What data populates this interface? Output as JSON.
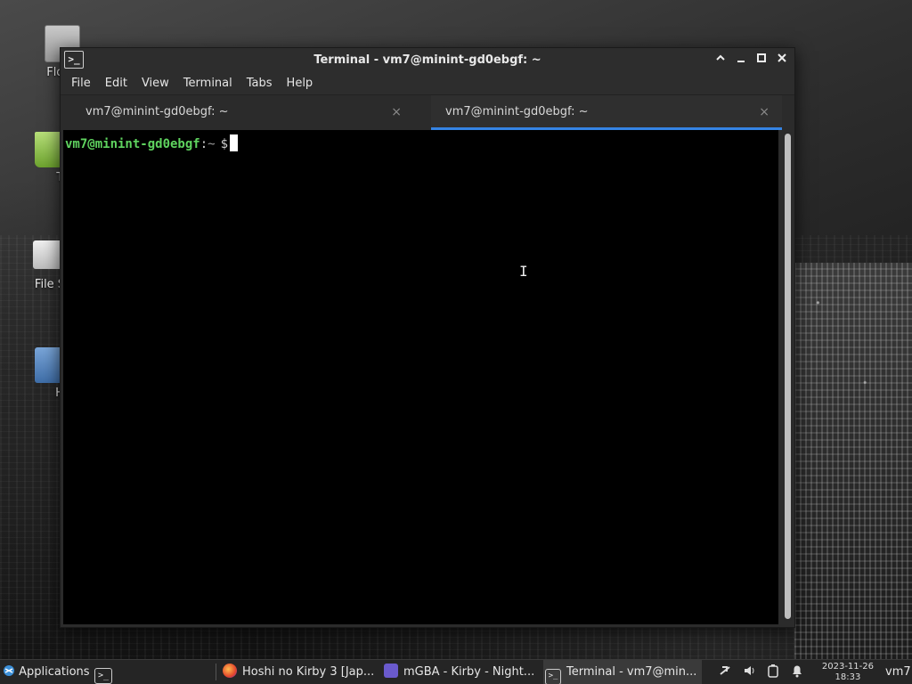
{
  "desktop": {
    "icons": [
      {
        "label": "Flopp"
      },
      {
        "label": "Tra"
      },
      {
        "label": "File S"
      },
      {
        "label": "Ho"
      }
    ]
  },
  "window": {
    "title": "Terminal - vm7@minint-gd0ebgf: ~",
    "controls": {
      "up": "▲",
      "minimize": "_",
      "maximize": "□",
      "close": "✕"
    },
    "menu": [
      "File",
      "Edit",
      "View",
      "Terminal",
      "Tabs",
      "Help"
    ],
    "tabs": [
      {
        "label": "vm7@minint-gd0ebgf: ~",
        "close": "×"
      },
      {
        "label": "vm7@minint-gd0ebgf: ~",
        "close": "×"
      }
    ],
    "terminal": {
      "user_host": "vm7@minint-gd0ebgf",
      "colon": ":",
      "path": "~",
      "symbol": "$"
    }
  },
  "taskbar": {
    "applications_label": "Applications",
    "tasks": [
      {
        "label": "Hoshi no Kirby 3 [Jap..."
      },
      {
        "label": "mGBA - Kirby - Night..."
      },
      {
        "label": "Terminal - vm7@min..."
      }
    ],
    "clock": {
      "date": "2023-11-26",
      "time": "18:33"
    },
    "user": "vm7"
  },
  "colors": {
    "accent": "#3584e4",
    "prompt_user": "#5fd35f",
    "terminal_bg": "#000000"
  }
}
